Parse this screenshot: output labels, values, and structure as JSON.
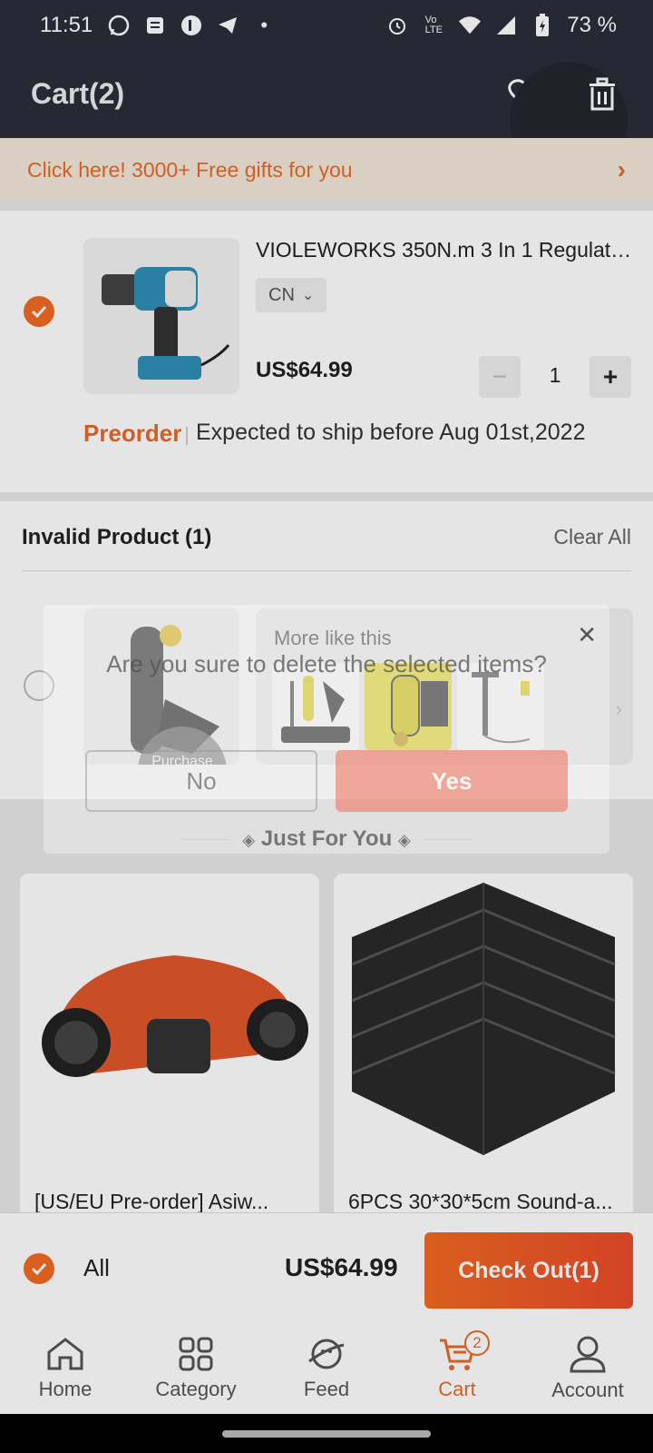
{
  "status_bar": {
    "time": "11:51",
    "battery": "73 %"
  },
  "header": {
    "title": "Cart(2)"
  },
  "promo": {
    "text": "Click here! 3000+ Free gifts for you"
  },
  "cart_item": {
    "name": "VIOLEWORKS 350N.m 3 In 1 Regulate...",
    "variant": "CN",
    "price": "US$64.99",
    "quantity": "1",
    "preorder_label": "Preorder",
    "ship_text": "Expected to ship before Aug 01st,2022",
    "selected": true
  },
  "invalid_section": {
    "title": "Invalid Product (1)",
    "clear_label": "Clear All",
    "unavailable_text": "Purchase unavaila...",
    "more_like_title": "More like this"
  },
  "just_for_you": {
    "title": "Just For You"
  },
  "recommendations": [
    {
      "title": "[US/EU Pre-order] Asiw..."
    },
    {
      "title": "6PCS 30*30*5cm Sound-a..."
    }
  ],
  "footer": {
    "all_label": "All",
    "total": "US$64.99",
    "checkout_label": "Check Out(1)"
  },
  "nav": {
    "items": [
      {
        "label": "Home",
        "icon": "home-icon"
      },
      {
        "label": "Category",
        "icon": "category-icon"
      },
      {
        "label": "Feed",
        "icon": "feed-icon"
      },
      {
        "label": "Cart",
        "icon": "cart-icon",
        "badge": "2",
        "active": true
      },
      {
        "label": "Account",
        "icon": "account-icon"
      }
    ]
  },
  "dialog": {
    "message": "Are you sure to delete the selected items?",
    "no_label": "No",
    "yes_label": "Yes"
  },
  "colors": {
    "accent": "#e86a2a",
    "header_bg": "#2b2d3a",
    "promo_bg": "#f3e7da"
  }
}
